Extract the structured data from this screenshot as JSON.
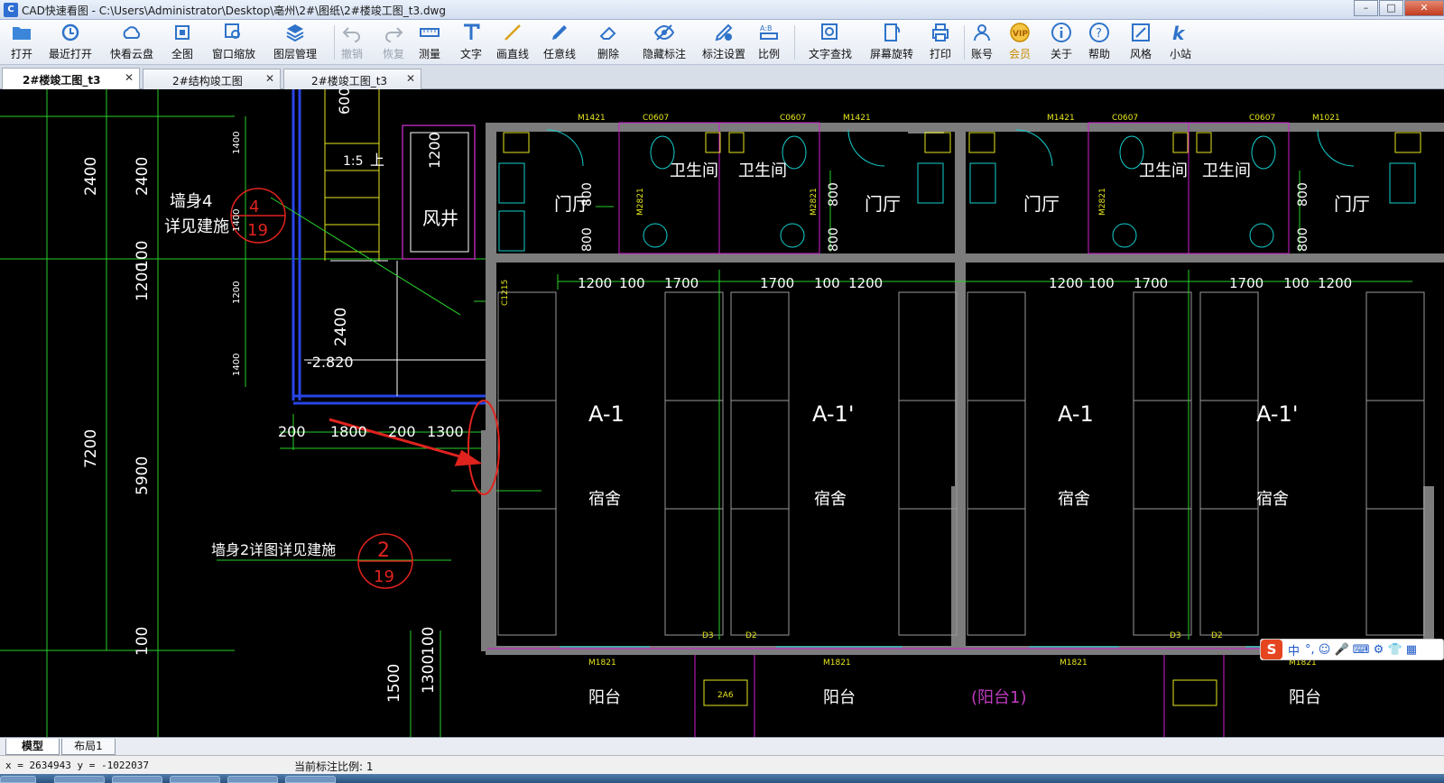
{
  "window": {
    "title": "CAD快速看图 - C:\\Users\\Administrator\\Desktop\\亳州\\2#\\图纸\\2#楼竣工图_t3.dwg",
    "buttons": {
      "minimize": "–",
      "maximize": "□",
      "close": "✕"
    }
  },
  "toolbar": {
    "items": [
      {
        "label": "打开",
        "icon": "folder-open-icon"
      },
      {
        "label": "最近打开",
        "icon": "history-icon"
      },
      {
        "label": "快看云盘",
        "icon": "cloud-icon"
      },
      {
        "label": "全图",
        "icon": "fit-all-icon"
      },
      {
        "label": "窗口缩放",
        "icon": "zoom-window-icon"
      },
      {
        "label": "图层管理",
        "icon": "layers-icon"
      },
      {
        "label": "撤销",
        "icon": "undo-icon"
      },
      {
        "label": "恢复",
        "icon": "redo-icon"
      },
      {
        "label": "测量",
        "icon": "ruler-icon"
      },
      {
        "label": "文字",
        "icon": "text-icon"
      },
      {
        "label": "画直线",
        "icon": "line-icon"
      },
      {
        "label": "任意线",
        "icon": "pen-icon"
      },
      {
        "label": "删除",
        "icon": "eraser-icon"
      },
      {
        "label": "隐藏标注",
        "icon": "eye-icon"
      },
      {
        "label": "标注设置",
        "icon": "annotation-settings-icon"
      },
      {
        "label": "比例",
        "icon": "scale-icon"
      },
      {
        "label": "文字查找",
        "icon": "find-text-icon"
      },
      {
        "label": "屏幕旋转",
        "icon": "rotate-screen-icon"
      },
      {
        "label": "打印",
        "icon": "printer-icon"
      },
      {
        "label": "账号",
        "icon": "user-icon"
      },
      {
        "label": "会员",
        "icon": "vip-icon"
      },
      {
        "label": "关于",
        "icon": "info-icon"
      },
      {
        "label": "帮助",
        "icon": "help-icon"
      },
      {
        "label": "风格",
        "icon": "style-icon"
      },
      {
        "label": "小站",
        "icon": "k-station-icon"
      }
    ]
  },
  "tabs": [
    {
      "label": "2#楼竣工图_t3",
      "close": "✕"
    },
    {
      "label": "2#结构竣工图",
      "close": "✕"
    },
    {
      "label": "2#楼竣工图_t3",
      "close": "✕"
    }
  ],
  "drawing": {
    "left_dims": [
      "2400",
      "2400",
      "100",
      "1200",
      "7200",
      "5900",
      "100",
      "1500",
      "1300",
      "100"
    ],
    "stair_dims": [
      "600",
      "1400",
      "1400",
      "1200",
      "1400",
      "2400",
      "1200"
    ],
    "stair_text": [
      "1:5",
      "上"
    ],
    "elevation": "-2.820",
    "bottom_dims": [
      "200",
      "1800",
      "200",
      "1300"
    ],
    "wind_shaft": "风井",
    "notes": [
      {
        "line1": "墙身4",
        "line2": "详见建施",
        "mark_top": "4",
        "mark_bottom": "19"
      },
      {
        "line1": "墙身2详图详见建施",
        "mark_top": "2",
        "mark_bottom": "19"
      }
    ],
    "doors": [
      "M1421",
      "C0607",
      "C0607",
      "M1421",
      "M1421",
      "C0607",
      "C0607",
      "M1021",
      "M1821",
      "M1821",
      "M1821",
      "M1821"
    ],
    "rooms": {
      "bathroom": "卫生间",
      "hall": "门厅",
      "dorm": "宿舍",
      "balcony": "阳台",
      "balcony_alt": "(阳台1)",
      "units": [
        "A-1",
        "A-1'",
        "A-1",
        "A-1'"
      ]
    },
    "unit_dims": [
      "1200",
      "100",
      "1700",
      "1700",
      "100",
      "1200",
      "1200",
      "100",
      "1700",
      "1700",
      "100",
      "1200"
    ],
    "room_dims": [
      "800",
      "800",
      "800",
      "800",
      "800",
      "800"
    ],
    "small_tags": [
      "M2821",
      "M2821",
      "M2821",
      "C1215",
      "D3",
      "D2",
      "D3",
      "D2",
      "2A6"
    ]
  },
  "ime": {
    "logo": "S",
    "mode": "中",
    "glyphs": "°, ☺ 🎤 ⌨ ⚙ 👕 ▦"
  },
  "layout_tabs": [
    "模型",
    "布局1"
  ],
  "status": {
    "coords": "x = 2634943  y = -1022037",
    "scale": "当前标注比例: 1"
  },
  "colors": {
    "canvas_bg": "#000000",
    "dim_green": "#27d127",
    "wall_gray": "#7c7c7c",
    "magenta": "#d01ed0",
    "cyan": "#14d0d0",
    "yellow": "#e6e61e",
    "red_mark": "#e0231e",
    "blue_wall": "#2845e6",
    "white_text": "#ffffff"
  }
}
